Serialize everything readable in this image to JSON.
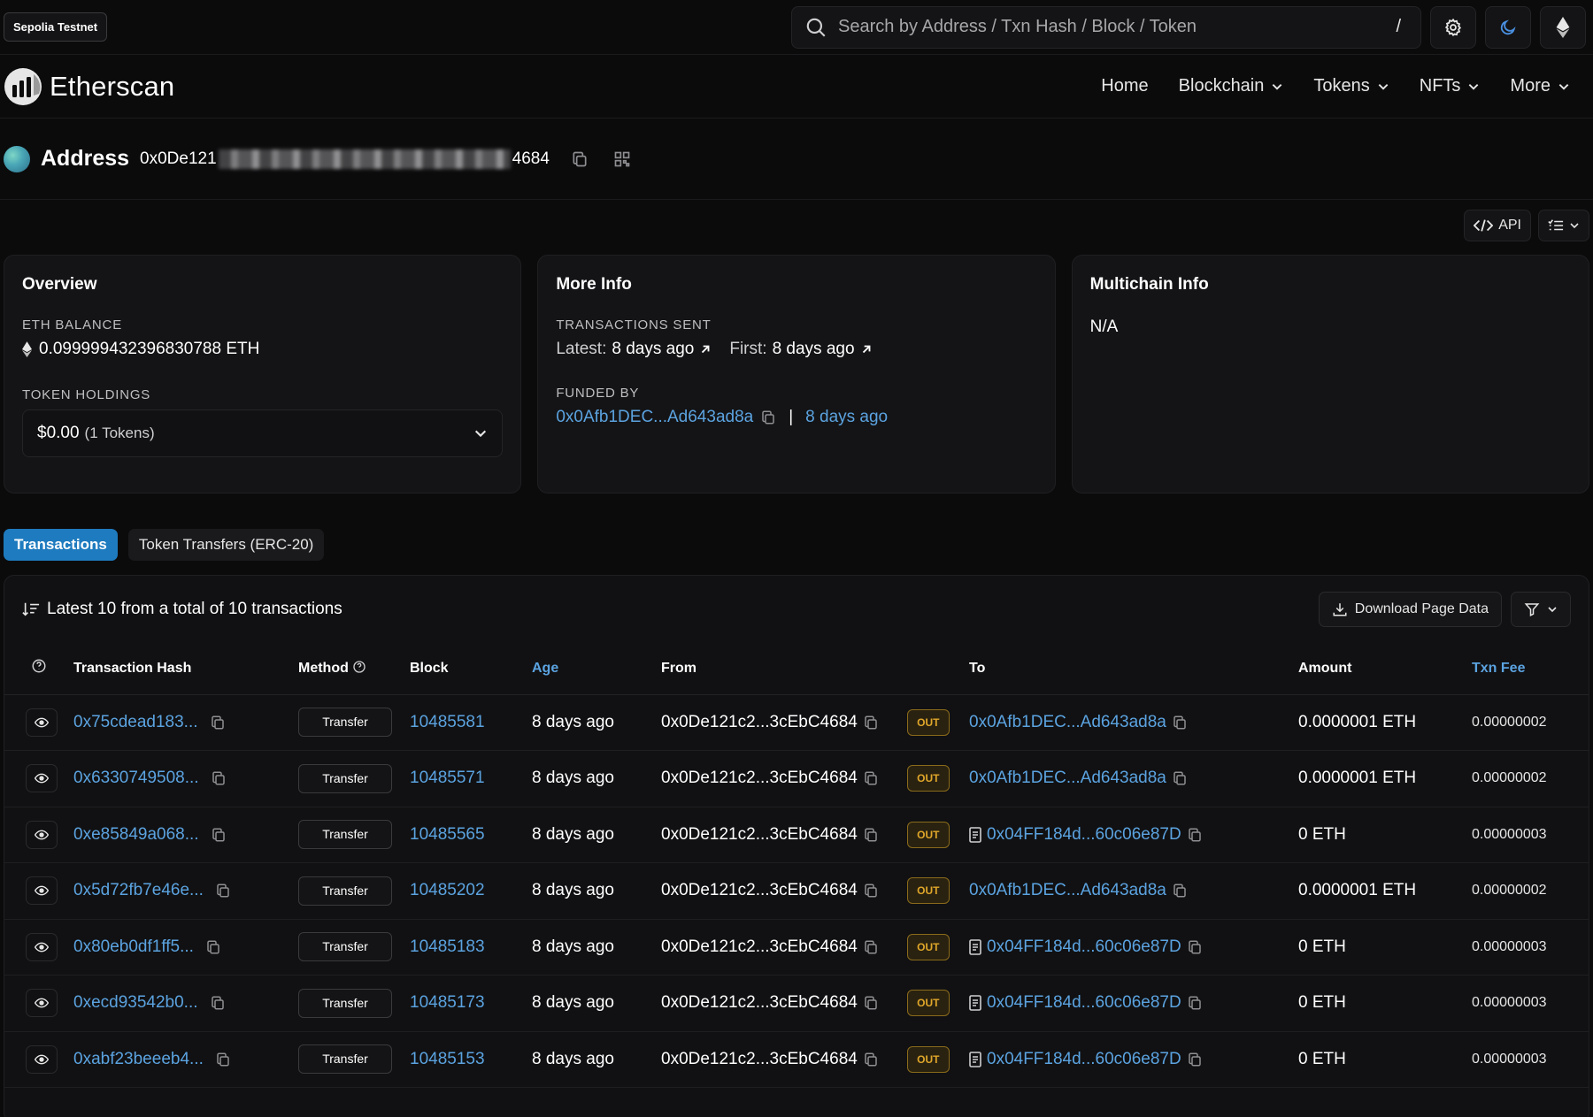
{
  "topbar": {
    "network": "Sepolia Testnet",
    "search_placeholder": "Search by Address / Txn Hash / Block / Token",
    "search_shortcut": "/"
  },
  "nav": {
    "logo_text": "Etherscan",
    "items": [
      "Home",
      "Blockchain",
      "Tokens",
      "NFTs",
      "More"
    ]
  },
  "address": {
    "title": "Address",
    "prefix": "0x0De121",
    "suffix": "4684"
  },
  "tools": {
    "api_label": "API"
  },
  "overview": {
    "title": "Overview",
    "eth_balance_label": "ETH BALANCE",
    "eth_balance": "0.099999432396830788 ETH",
    "token_holdings_label": "TOKEN HOLDINGS",
    "token_value": "$0.00",
    "token_count": "(1 Tokens)"
  },
  "more_info": {
    "title": "More Info",
    "tx_sent_label": "TRANSACTIONS SENT",
    "latest_label": "Latest:",
    "latest_value": "8 days ago",
    "first_label": "First:",
    "first_value": "8 days ago",
    "funded_by_label": "FUNDED BY",
    "funded_by_address": "0x0Afb1DEC...Ad643ad8a",
    "funded_sep": "|",
    "funded_time": "8 days ago"
  },
  "multichain": {
    "title": "Multichain Info",
    "value": "N/A"
  },
  "tabs": [
    "Transactions",
    "Token Transfers (ERC-20)"
  ],
  "table": {
    "summary": "Latest 10 from a total of 10 transactions",
    "download_label": "Download Page Data",
    "columns": {
      "hash": "Transaction Hash",
      "method": "Method",
      "block": "Block",
      "age": "Age",
      "from": "From",
      "to": "To",
      "amount": "Amount",
      "fee": "Txn Fee"
    },
    "rows": [
      {
        "hash": "0x75cdead183...",
        "method": "Transfer",
        "block": "10485581",
        "age": "8 days ago",
        "from": "0x0De121c2...3cEbC4684",
        "dir": "OUT",
        "to": "0x0Afb1DEC...Ad643ad8a",
        "contract": false,
        "amount": "0.0000001 ETH",
        "fee": "0.00000002"
      },
      {
        "hash": "0x6330749508...",
        "method": "Transfer",
        "block": "10485571",
        "age": "8 days ago",
        "from": "0x0De121c2...3cEbC4684",
        "dir": "OUT",
        "to": "0x0Afb1DEC...Ad643ad8a",
        "contract": false,
        "amount": "0.0000001 ETH",
        "fee": "0.00000002"
      },
      {
        "hash": "0xe85849a068...",
        "method": "Transfer",
        "block": "10485565",
        "age": "8 days ago",
        "from": "0x0De121c2...3cEbC4684",
        "dir": "OUT",
        "to": "0x04FF184d...60c06e87D",
        "contract": true,
        "amount": "0 ETH",
        "fee": "0.00000003"
      },
      {
        "hash": "0x5d72fb7e46e...",
        "method": "Transfer",
        "block": "10485202",
        "age": "8 days ago",
        "from": "0x0De121c2...3cEbC4684",
        "dir": "OUT",
        "to": "0x0Afb1DEC...Ad643ad8a",
        "contract": false,
        "amount": "0.0000001 ETH",
        "fee": "0.00000002"
      },
      {
        "hash": "0x80eb0df1ff5...",
        "method": "Transfer",
        "block": "10485183",
        "age": "8 days ago",
        "from": "0x0De121c2...3cEbC4684",
        "dir": "OUT",
        "to": "0x04FF184d...60c06e87D",
        "contract": true,
        "amount": "0 ETH",
        "fee": "0.00000003"
      },
      {
        "hash": "0xecd93542b0...",
        "method": "Transfer",
        "block": "10485173",
        "age": "8 days ago",
        "from": "0x0De121c2...3cEbC4684",
        "dir": "OUT",
        "to": "0x04FF184d...60c06e87D",
        "contract": true,
        "amount": "0 ETH",
        "fee": "0.00000003"
      },
      {
        "hash": "0xabf23beeeb4...",
        "method": "Transfer",
        "block": "10485153",
        "age": "8 days ago",
        "from": "0x0De121c2...3cEbC4684",
        "dir": "OUT",
        "to": "0x04FF184d...60c06e87D",
        "contract": true,
        "amount": "0 ETH",
        "fee": "0.00000003"
      }
    ]
  },
  "colors": {
    "background": "#0b0b0c",
    "card": "#141416",
    "link": "#5ba3e0",
    "tab_active": "#1e7bbf",
    "out_badge": "#e0a72a"
  }
}
